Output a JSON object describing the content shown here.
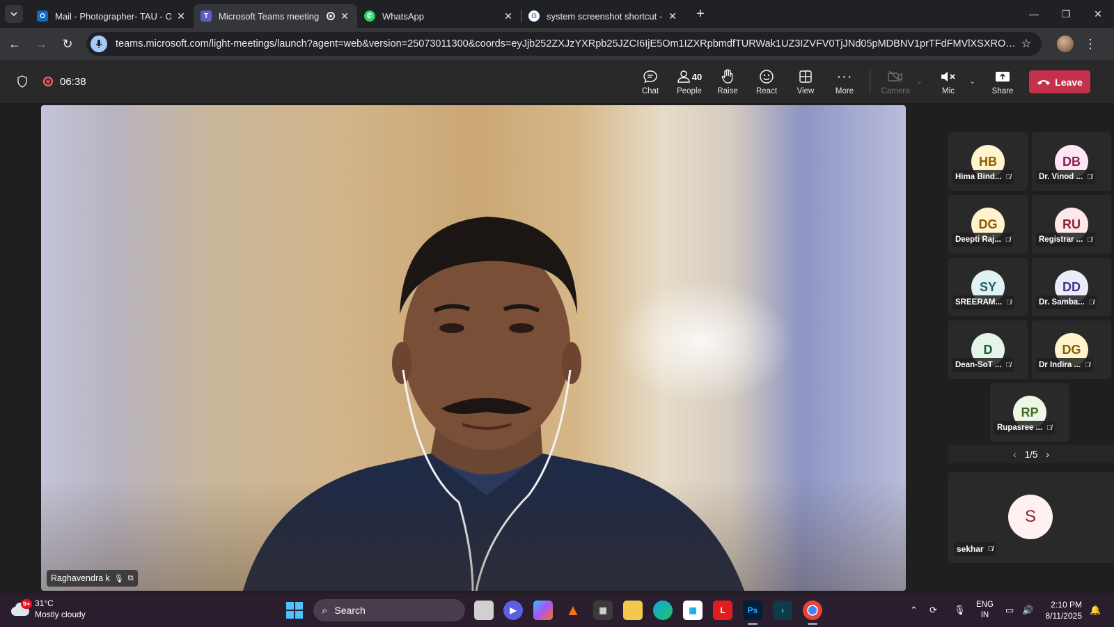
{
  "browser": {
    "tabs": [
      {
        "title": "Mail - Photographer- TAU - Outlook",
        "icon": "outlook-icon",
        "color": "#0f6cbd"
      },
      {
        "title": "Microsoft Teams meeting | Microsoft Teams",
        "icon": "teams-icon",
        "color": "#5b5fc7"
      },
      {
        "title": "WhatsApp",
        "icon": "whatsapp-icon",
        "color": "#25d366"
      },
      {
        "title": "system screenshot shortcut - Google Search",
        "icon": "google-icon",
        "color": "#4285f4"
      }
    ],
    "url": "teams.microsoft.com/light-meetings/launch?agent=web&version=25073011300&coords=eyJjb252ZXJzYXRpb25JZCI6IjE5Om1IZXRpbmdfTURWak1UZ3IZVFV0TjJNd05pMDBNV1prTFdFMVlXSXROVEE0T1dabFIUZ..."
  },
  "meeting": {
    "timer": "06:38",
    "controls": {
      "chat": "Chat",
      "people": "People",
      "people_count": "40",
      "raise": "Raise",
      "react": "React",
      "view": "View",
      "more": "More",
      "camera": "Camera",
      "mic": "Mic",
      "share": "Share",
      "leave": "Leave"
    },
    "speaker_name": "Raghavendra k",
    "participants": [
      {
        "initials": "HB",
        "name": "Hima Bind...",
        "bg": "#fff4ce",
        "fg": "#8a5a00"
      },
      {
        "initials": "DB",
        "name": "Dr. Vinod ...",
        "bg": "#fde7f3",
        "fg": "#8b1e5b"
      },
      {
        "initials": "DG",
        "name": "Deepti Raj...",
        "bg": "#fff4ce",
        "fg": "#8a5a00"
      },
      {
        "initials": "RU",
        "name": "Registrar ...",
        "bg": "#fde7e9",
        "fg": "#8b1e2e"
      },
      {
        "initials": "SY",
        "name": "SREERAM...",
        "bg": "#e0f2f1",
        "fg": "#1b5e70"
      },
      {
        "initials": "DD",
        "name": "Dr. Samba...",
        "bg": "#ecebf9",
        "fg": "#3b3a84"
      },
      {
        "initials": "D",
        "name": "Dean-SoT ...",
        "bg": "#e3f4e8",
        "fg": "#1e5a33"
      },
      {
        "initials": "DG",
        "name": "Dr Indira ...",
        "bg": "#fff4ce",
        "fg": "#8a5a00"
      },
      {
        "initials": "RP",
        "name": "Rupasree ...",
        "bg": "#eef6e6",
        "fg": "#3f6b21"
      }
    ],
    "pager": "1/5",
    "featured": {
      "initial": "S",
      "name": "sekhar"
    }
  },
  "taskbar": {
    "weather_badge": "9+",
    "temperature": "31°C",
    "weather_desc": "Mostly cloudy",
    "search_label": "Search",
    "lang_top": "ENG",
    "lang_bottom": "IN",
    "time": "2:10 PM",
    "date": "8/11/2025"
  }
}
